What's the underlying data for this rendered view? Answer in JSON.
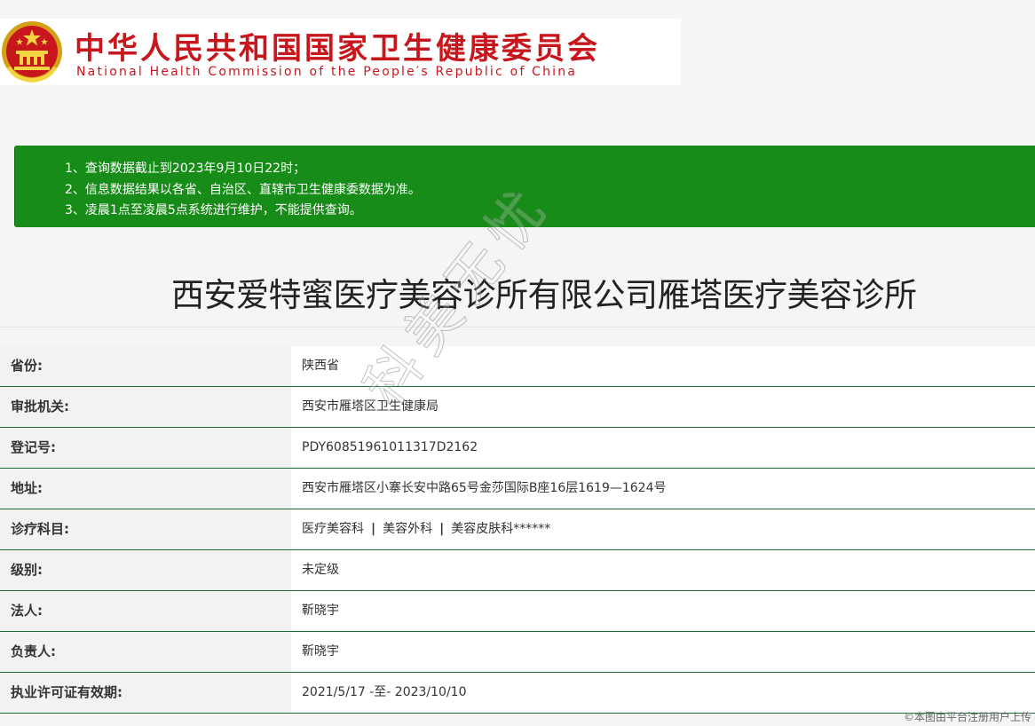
{
  "header": {
    "title_cn": "中华人民共和国国家卫生健康委员会",
    "title_en": "National Health Commission of the People′s Republic of China"
  },
  "notice": {
    "lines": [
      "1、查询数据截止到2023年9月10日22时；",
      "2、信息数据结果以各省、自治区、直辖市卫生健康委数据为准。",
      "3、凌晨1点至凌晨5点系统进行维护，不能提供查询。"
    ]
  },
  "org_name": "西安爱特蜜医疗美容诊所有限公司雁塔医疗美容诊所",
  "rows": [
    {
      "label": "省份:",
      "value": "陕西省"
    },
    {
      "label": "审批机关:",
      "value": "西安市雁塔区卫生健康局"
    },
    {
      "label": "登记号:",
      "value": "PDY60851961011317D2162"
    },
    {
      "label": "地址:",
      "value": "西安市雁塔区小寨长安中路65号金莎国际B座16层1619—1624号"
    },
    {
      "label": "诊疗科目:",
      "items": [
        "医疗美容科",
        "美容外科",
        "美容皮肤科******"
      ],
      "separator": "|"
    },
    {
      "label": "级别:",
      "value": "未定级"
    },
    {
      "label": "法人:",
      "value": "靳晓宇"
    },
    {
      "label": "负责人:",
      "value": "靳晓宇"
    },
    {
      "label": "执业许可证有效期:",
      "value": "2021/5/17 -至- 2023/10/10"
    }
  ],
  "watermark": "科美无忧",
  "footnote": "©本图由平台注册用户上传",
  "colors": {
    "brand_red": "#c8161d",
    "notice_green": "#188c18",
    "row_border": "#1e6e3a"
  }
}
